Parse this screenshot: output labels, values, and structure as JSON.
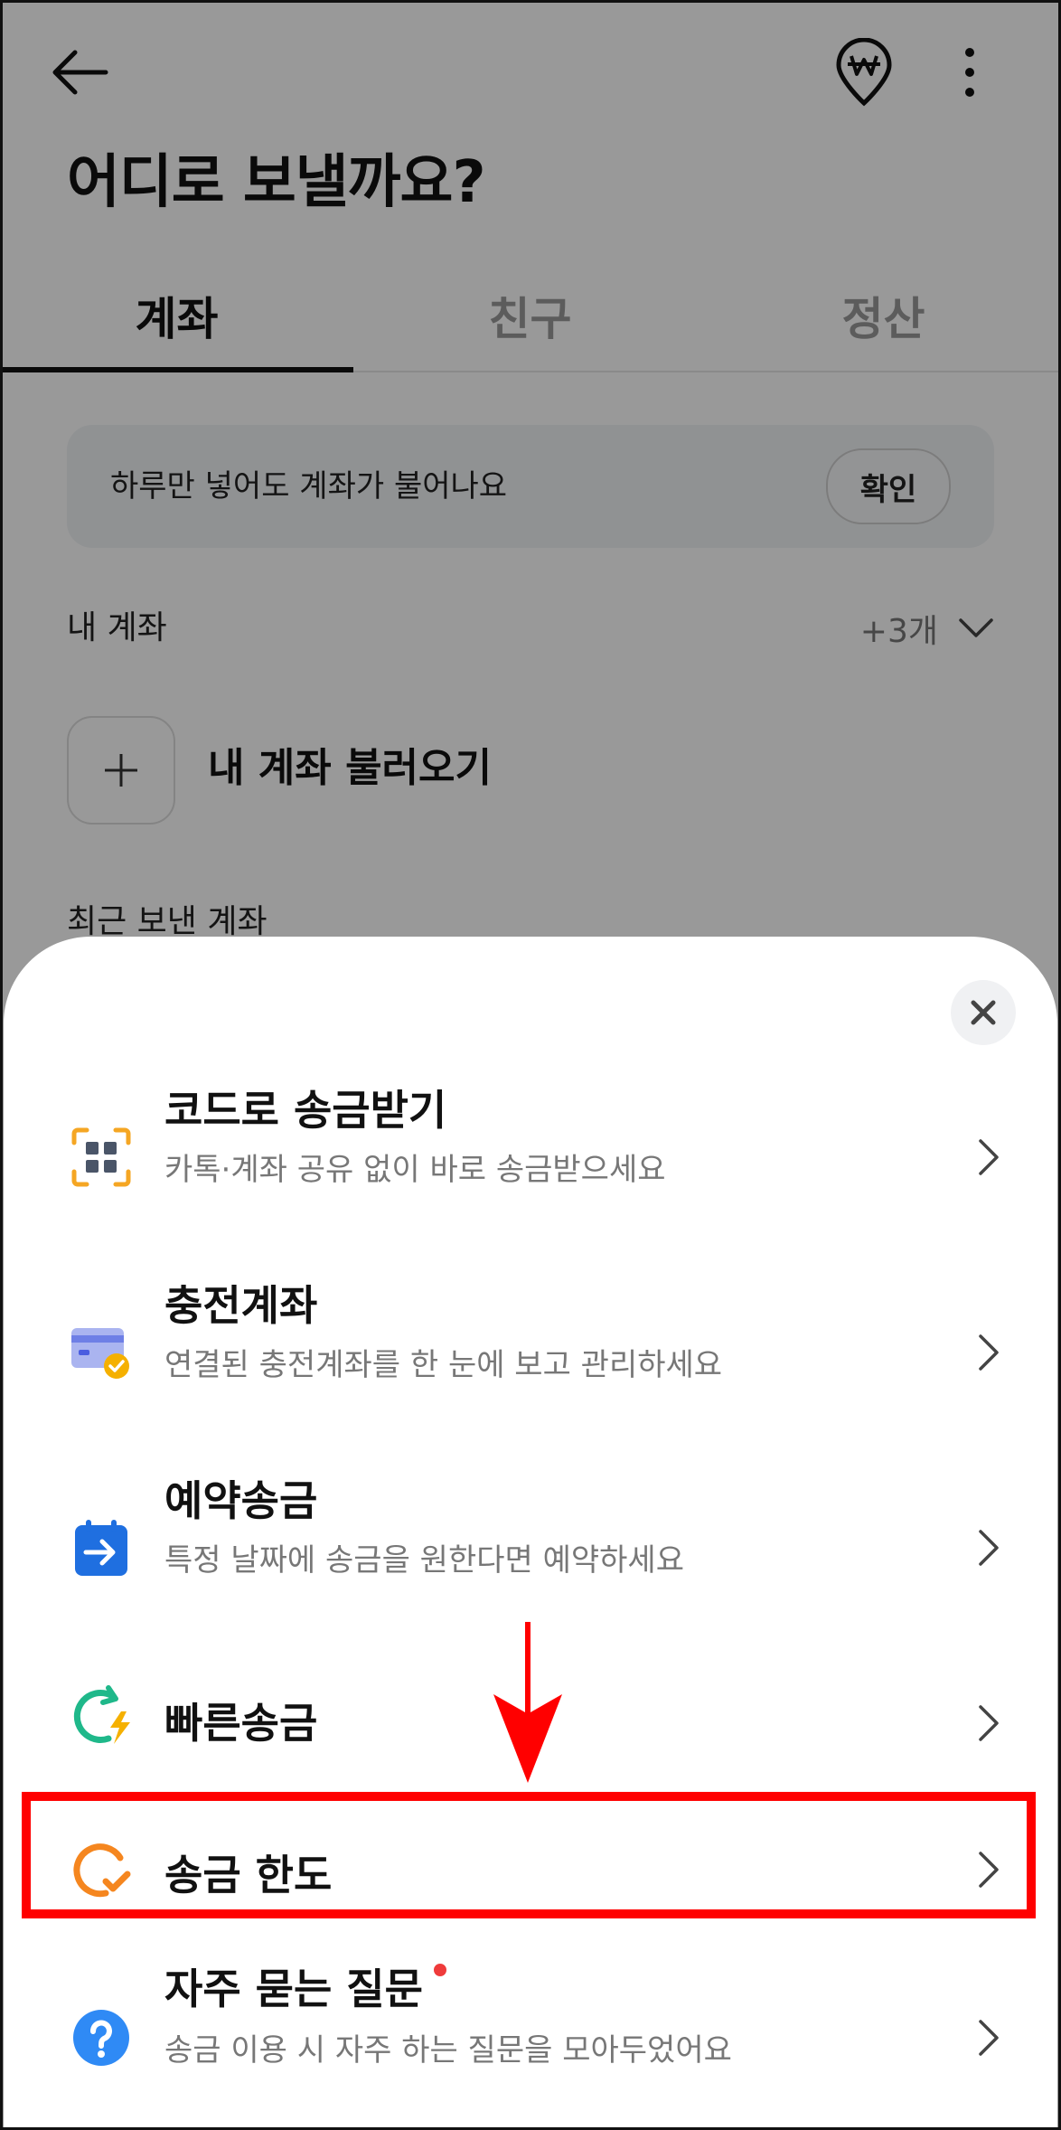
{
  "header": {
    "back_icon": "arrow-left-icon",
    "won_icon": "won-pin-icon",
    "more_icon": "more-vertical-icon",
    "title": "어디로 보낼까요?"
  },
  "tabs": [
    {
      "label": "계좌",
      "active": true
    },
    {
      "label": "친구",
      "active": false
    },
    {
      "label": "정산",
      "active": false
    }
  ],
  "banner": {
    "text": "하루만 넣어도 계좌가 불어나요",
    "button": "확인"
  },
  "my_accounts": {
    "label": "내 계좌",
    "count": "+3개"
  },
  "import_account": {
    "label": "내 계좌 불러오기"
  },
  "recent": {
    "label": "최근 보낸 계좌"
  },
  "sheet": {
    "items": [
      {
        "title": "코드로 송금받기",
        "subtitle": "카톡·계좌 공유 없이 바로 송금받으세요",
        "icon": "qr-code-icon"
      },
      {
        "title": "충전계좌",
        "subtitle": "연결된 충전계좌를 한 눈에 보고 관리하세요",
        "icon": "card-check-icon"
      },
      {
        "title": "예약송금",
        "subtitle": "특정 날짜에 송금을 원한다면 예약하세요",
        "icon": "calendar-arrow-icon"
      },
      {
        "title": "빠른송금",
        "subtitle": "",
        "icon": "fast-transfer-icon"
      },
      {
        "title": "송금 한도",
        "subtitle": "",
        "icon": "limit-check-icon"
      },
      {
        "title": "자주 묻는 질문",
        "subtitle": "송금 이용 시 자주 하는 질문을 모아두었어요",
        "icon": "question-icon"
      }
    ]
  },
  "colors": {
    "accent_orange": "#f5a623",
    "accent_blue": "#2f80ed",
    "accent_green": "#1fb88a",
    "highlight_red": "#ff0000"
  }
}
